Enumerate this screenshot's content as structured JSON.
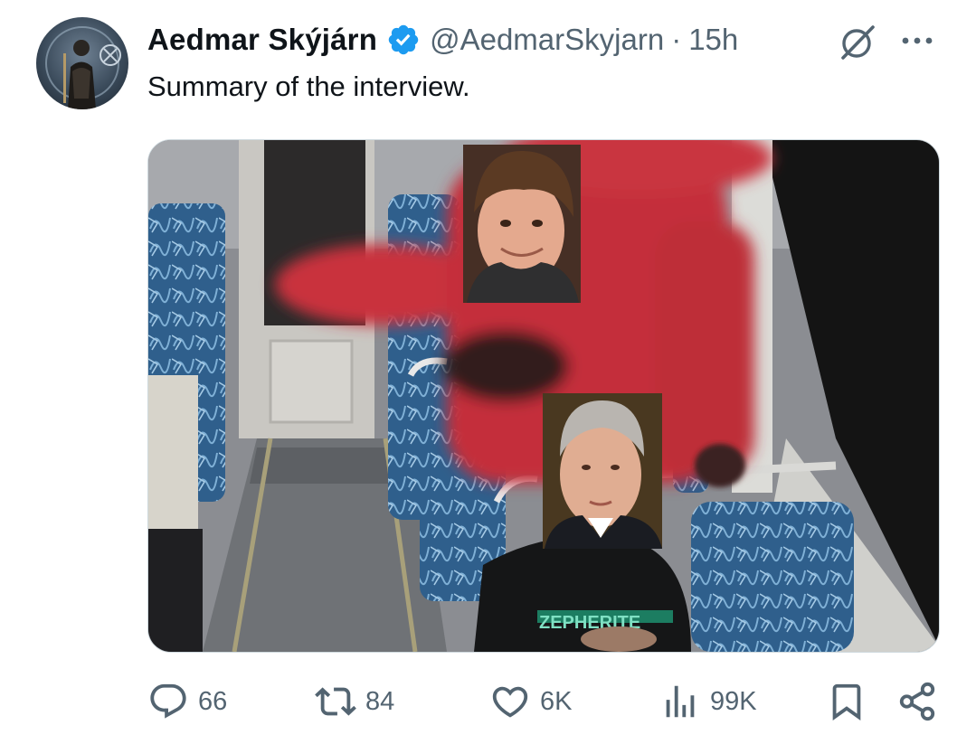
{
  "author": {
    "display_name": "Aedmar Skýjárn",
    "handle": "@AedmarSkyjarn",
    "separator": "·",
    "timestamp": "15h",
    "verified": true
  },
  "tweet": {
    "text": "Summary of the interview."
  },
  "media": {
    "overlay_caption": "ZEPHERITE"
  },
  "actions": {
    "replies": "66",
    "reposts": "84",
    "likes": "6K",
    "views": "99K"
  },
  "colors": {
    "text_primary": "#0f1419",
    "text_secondary": "#536471",
    "verified_blue": "#1d9bf0",
    "border": "#cfd9de"
  },
  "icons": [
    "grok-icon",
    "more-icon",
    "reply-icon",
    "repost-icon",
    "like-icon",
    "views-icon",
    "bookmark-icon",
    "share-icon",
    "verified-badge-icon"
  ]
}
